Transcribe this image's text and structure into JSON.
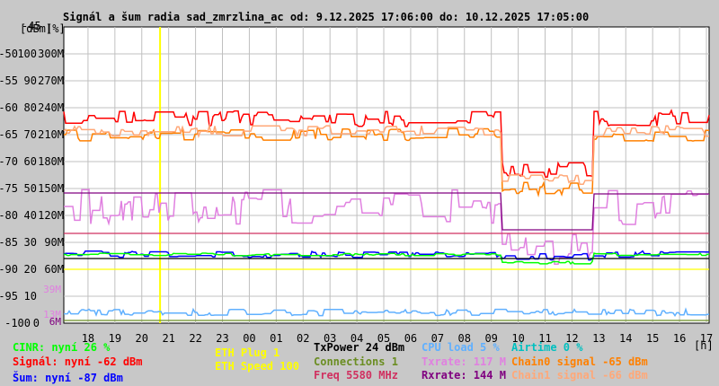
{
  "chart_data": {
    "type": "line",
    "title": "Signál a šum radia sad_zmrzlina_ac od: 9.12.2025 17:06:00 do: 10.12.2025 17:05:00",
    "y_units": [
      "[dBm]",
      "[%]"
    ],
    "y_top_label": "-45",
    "y_ticks": [
      {
        "dbm": "-50",
        "pct": "100",
        "m": "300M"
      },
      {
        "dbm": "-55",
        "pct": "90",
        "m": "270M"
      },
      {
        "dbm": "-60",
        "pct": "80",
        "m": "240M"
      },
      {
        "dbm": "-65",
        "pct": "70",
        "m": "210M"
      },
      {
        "dbm": "-70",
        "pct": "60",
        "m": "180M"
      },
      {
        "dbm": "-75",
        "pct": "50",
        "m": "150M"
      },
      {
        "dbm": "-80",
        "pct": "40",
        "m": "120M"
      },
      {
        "dbm": "-85",
        "pct": "30",
        "m": "90M"
      },
      {
        "dbm": "-90",
        "pct": "20",
        "m": "60M"
      },
      {
        "dbm": "-95",
        "pct": "10",
        "m": ""
      },
      {
        "dbm": "-100",
        "pct": "0",
        "m": ""
      }
    ],
    "ylim_dbm": [
      -100,
      -45
    ],
    "x_ticks": [
      "18",
      "19",
      "20",
      "21",
      "22",
      "23",
      "00",
      "01",
      "02",
      "03",
      "04",
      "05",
      "06",
      "07",
      "08",
      "09",
      "10",
      "11",
      "12",
      "13",
      "14",
      "15",
      "16",
      "17"
    ],
    "x_unit": "[h]",
    "x_range_hours": [
      0,
      24
    ],
    "x_start": "17:06",
    "grid": true,
    "marker_line_hour": 3.58,
    "side_labels": [
      {
        "text": "39M",
        "color": "#e080e0"
      },
      {
        "text": "13M",
        "color": "#e080e0"
      },
      {
        "text": "6M",
        "color": "#800080"
      }
    ],
    "series": [
      {
        "name": "Signál",
        "unit": "dBm",
        "color": "#ff0000",
        "segments": [
          [
            0,
            16.28,
            -62
          ],
          [
            16.28,
            19.7,
            -71.5
          ],
          [
            19.7,
            24,
            -62
          ]
        ],
        "noise": 1.5
      },
      {
        "name": "Chain0 signal",
        "unit": "dBm",
        "color": "#ff8000",
        "segments": [
          [
            0,
            16.28,
            -65
          ],
          [
            16.28,
            19.7,
            -75
          ],
          [
            19.7,
            24,
            -65
          ]
        ],
        "noise": 1.2
      },
      {
        "name": "Chain1 signal",
        "unit": "dBm",
        "color": "#ffa878",
        "segments": [
          [
            0,
            16.28,
            -64.3
          ],
          [
            16.28,
            19.7,
            -73.3
          ],
          [
            19.7,
            24,
            -64.3
          ]
        ],
        "noise": 1.0
      },
      {
        "name": "Txrate",
        "unit": "M",
        "color": "#e080e0",
        "segments": [
          [
            0,
            16.28,
            130
          ],
          [
            16.28,
            19.7,
            80
          ],
          [
            19.7,
            24,
            130
          ]
        ],
        "noise": 20
      },
      {
        "name": "Rxrate",
        "unit": "M",
        "color": "#800080",
        "segments": [
          [
            0,
            16.28,
            145
          ],
          [
            16.28,
            19.7,
            104
          ],
          [
            19.7,
            24,
            144
          ]
        ],
        "noise": 0
      },
      {
        "name": "Freq",
        "unit": "M",
        "color": "#d03060",
        "segments": [
          [
            0,
            24,
            100
          ]
        ],
        "noise": 0
      },
      {
        "name": "Šum",
        "unit": "dBm",
        "color": "#0000ff",
        "segments": [
          [
            0,
            16.28,
            -87.2
          ],
          [
            16.28,
            19.7,
            -87.7
          ],
          [
            19.7,
            24,
            -87.2
          ]
        ],
        "noise": 0.6
      },
      {
        "name": "CINR",
        "unit": "%",
        "color": "#00ff00",
        "segments": [
          [
            0,
            16.28,
            25.5
          ],
          [
            16.28,
            19.7,
            22.5
          ],
          [
            19.7,
            24,
            25.5
          ]
        ],
        "noise": 0.5
      },
      {
        "name": "TxPower",
        "unit": "M",
        "color": "#000000",
        "segments": [
          [
            0,
            24,
            72
          ]
        ],
        "noise": 0
      },
      {
        "name": "ETH Speed",
        "unit": "M",
        "color": "#ffff00",
        "segments": [
          [
            0,
            24,
            60
          ]
        ],
        "noise": 0
      },
      {
        "name": "CPU load",
        "unit": "%",
        "color": "#60b0ff",
        "segments": [
          [
            0,
            24,
            4
          ]
        ],
        "noise": 1.2
      },
      {
        "name": "Connections",
        "unit": "%",
        "color": "#6b8e23",
        "segments": [
          [
            0,
            24,
            1
          ]
        ],
        "noise": 0
      }
    ]
  },
  "legend": {
    "cinr": {
      "text": "CINR: nyní 26 %",
      "color": "#00ff00"
    },
    "signal": {
      "text": "Signál: nyní -62 dBm",
      "color": "#ff0000"
    },
    "noise": {
      "text": "Šum: nyní -87 dBm",
      "color": "#0000ff"
    },
    "eth_plug": {
      "text": "ETH Plug 1",
      "color": "#ffff00"
    },
    "eth_speed": {
      "text": "ETH Speed 100",
      "color": "#ffff00"
    },
    "txpower": {
      "text": "TxPower 24 dBm",
      "color": "#000000"
    },
    "connections": {
      "text": "Connections 1",
      "color": "#6b8e23"
    },
    "freq": {
      "text": "Freq 5580 MHz",
      "color": "#d03060"
    },
    "cpu": {
      "text": "CPU load 5 %",
      "color": "#60b0ff"
    },
    "txrate": {
      "text": "Txrate: 117 M",
      "color": "#e080e0"
    },
    "rxrate": {
      "text": "Rxrate: 144 M",
      "color": "#800080"
    },
    "airtime": {
      "text": "Airtime 0 %",
      "color": "#00c0c0"
    },
    "chain0": {
      "text": "Chain0 signal -65 dBm",
      "color": "#ff8000"
    },
    "chain1": {
      "text": "Chain1 signal -66 dBm",
      "color": "#ffa878"
    }
  }
}
